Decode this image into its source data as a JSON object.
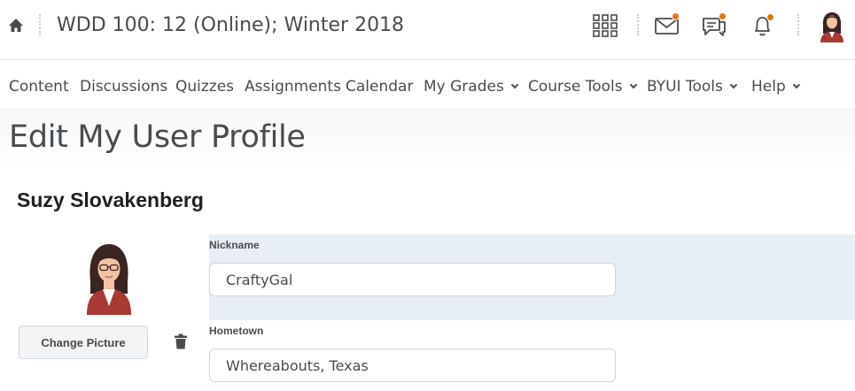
{
  "header": {
    "course_title": "WDD 100: 12 (Online); Winter 2018",
    "icons": [
      "home-icon",
      "apps-grid-icon",
      "mail-icon",
      "chat-icon",
      "bell-icon",
      "user-avatar"
    ],
    "notification_color": "#e87511"
  },
  "nav": {
    "items": [
      {
        "label": "Content",
        "dropdown": false
      },
      {
        "label": "Discussions",
        "dropdown": false
      },
      {
        "label": "Quizzes",
        "dropdown": false
      },
      {
        "label": "Assignments",
        "dropdown": false
      },
      {
        "label": "Calendar",
        "dropdown": false
      },
      {
        "label": "My Grades",
        "dropdown": true
      },
      {
        "label": "Course Tools",
        "dropdown": true
      },
      {
        "label": "BYUI Tools",
        "dropdown": true
      },
      {
        "label": "Help",
        "dropdown": true
      }
    ]
  },
  "page": {
    "title": "Edit My User Profile",
    "user_name": "Suzy Slovakenberg"
  },
  "profile": {
    "change_picture_label": "Change Picture",
    "fields": [
      {
        "label": "Nickname",
        "value": "CraftyGal"
      },
      {
        "label": "Hometown",
        "value": "Whereabouts, Texas"
      }
    ]
  }
}
